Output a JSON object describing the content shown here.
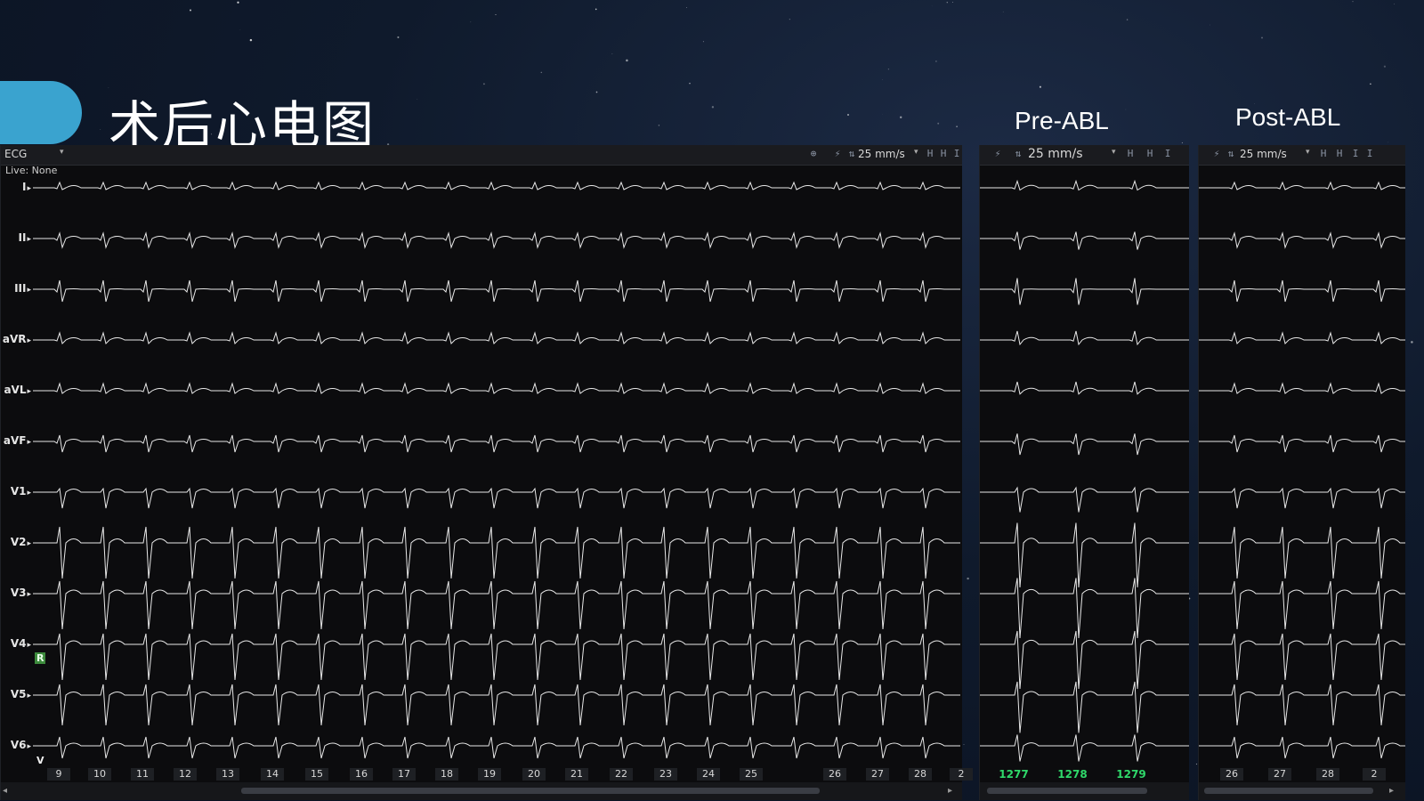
{
  "slide": {
    "title": "术后心电图",
    "pre_title": "Pre-ABL",
    "post_title": "Post-ABL"
  },
  "main_panel": {
    "dropdown_value": "ECG",
    "live_text": "Live: None",
    "speed": "25 mm/s",
    "leads": [
      "I",
      "II",
      "III",
      "aVR",
      "aVL",
      "aVF",
      "V1",
      "V2",
      "V3",
      "V4",
      "V5",
      "V6"
    ],
    "v4_badge": "R",
    "v6_badge": "V",
    "time_ticks": [
      "9",
      "10",
      "11",
      "12",
      "13",
      "14",
      "15",
      "16",
      "17",
      "18",
      "19",
      "20",
      "21",
      "22",
      "23",
      "24",
      "25",
      "26",
      "27",
      "28",
      "2"
    ]
  },
  "pre_panel": {
    "speed": "25 mm/s",
    "beat_numbers": [
      "1277",
      "1278",
      "1279"
    ]
  },
  "post_panel": {
    "speed": "25 mm/s",
    "time_ticks": [
      "26",
      "27",
      "28",
      "2"
    ]
  },
  "colors": {
    "accent": "#3aa3cf",
    "beat_label": "#2fd86a",
    "trace": "#e8e8e8",
    "panel_bg": "#0c0c0e"
  }
}
